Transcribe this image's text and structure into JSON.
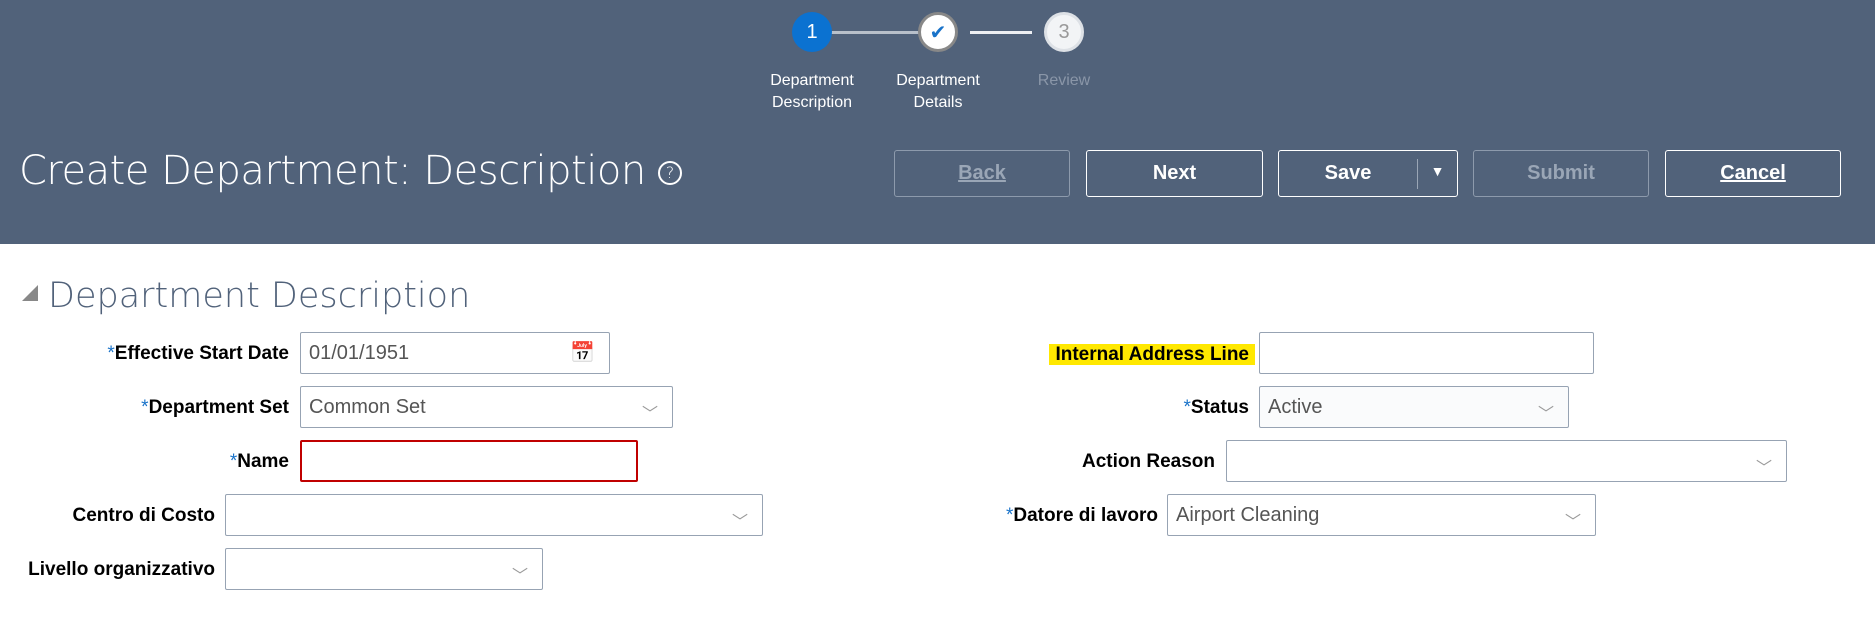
{
  "train": {
    "steps": [
      {
        "number": "1",
        "label": "Department Description"
      },
      {
        "number": "✔",
        "label": "Department Details"
      },
      {
        "number": "3",
        "label": "Review"
      }
    ]
  },
  "header": {
    "title": "Create Department: Description",
    "help": "?"
  },
  "buttons": {
    "back": "Back",
    "next": "Next",
    "save": "Save",
    "save_menu": "▼",
    "submit": "Submit",
    "cancel": "Cancel"
  },
  "section": {
    "title": "Department Description"
  },
  "form": {
    "required_mark": "*",
    "effective_start_date": {
      "label": "Effective Start Date",
      "value": "01/01/1951"
    },
    "department_set": {
      "label": "Department Set",
      "value": "Common Set"
    },
    "name": {
      "label": "Name",
      "value": ""
    },
    "centro_di_costo": {
      "label": "Centro di Costo",
      "value": ""
    },
    "livello_organizzativo": {
      "label": "Livello organizzativo",
      "value": ""
    },
    "internal_address_line": {
      "label": "Internal Address Line",
      "value": ""
    },
    "status": {
      "label": "Status",
      "value": "Active"
    },
    "action_reason": {
      "label": "Action Reason",
      "value": ""
    },
    "datore_di_lavoro": {
      "label": "Datore di lavoro",
      "value": "Airport Cleaning"
    }
  },
  "colors": {
    "header": "#51627a",
    "accent": "#0b72d1",
    "error": "#c00000",
    "highlight": "#ffe800"
  }
}
